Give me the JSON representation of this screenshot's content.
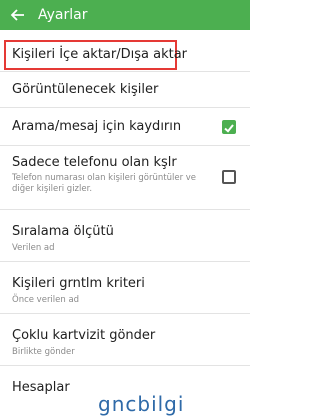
{
  "appbar": {
    "title": "Ayarlar"
  },
  "items": [
    {
      "title": "Kişileri İçe aktar/Dışa aktar"
    },
    {
      "title": "Görüntülenecek kişiler"
    },
    {
      "title": "Arama/mesaj için kaydırın",
      "checked": true
    },
    {
      "title": "Sadece telefonu olan kşlr",
      "subtitle": "Telefon numarası olan kişileri görüntüler ve diğer kişileri gizler.",
      "checked": false
    },
    {
      "title": "Sıralama ölçütü",
      "subtitle": "Verilen ad"
    },
    {
      "title": "Kişileri grntlm kriteri",
      "subtitle": "Önce verilen ad"
    },
    {
      "title": "Çoklu kartvizit gönder",
      "subtitle": "Birlikte gönder"
    },
    {
      "title": "Hesaplar"
    }
  ],
  "watermark": "gncbilgi",
  "colors": {
    "appbar": "#4caf50",
    "highlight": "#e53935",
    "checkbox_on": "#4caf50"
  },
  "icons": {
    "back": "arrow-left-icon",
    "check": "check-icon"
  }
}
